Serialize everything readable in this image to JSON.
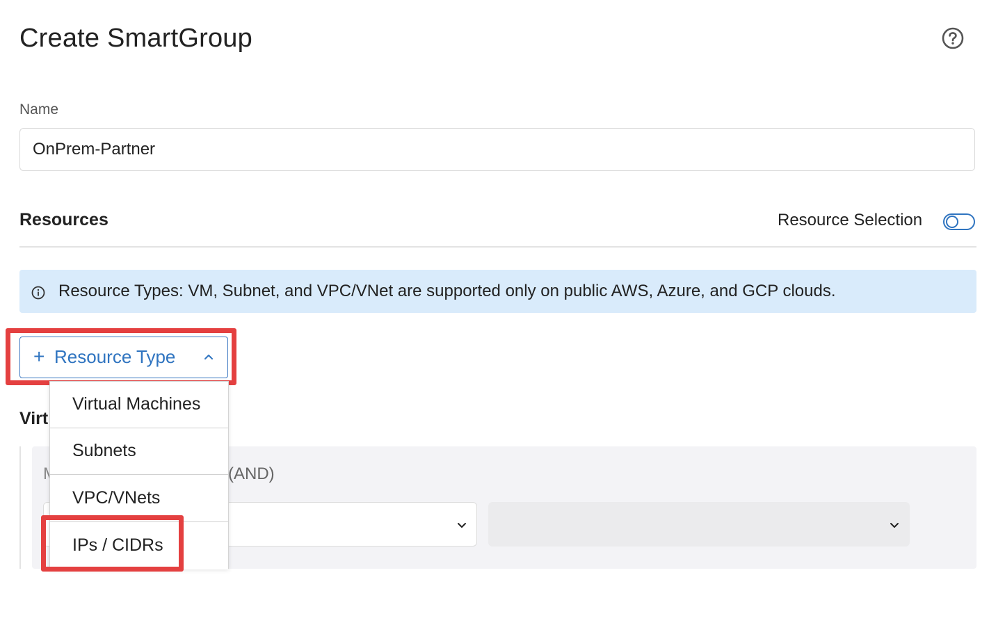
{
  "header": {
    "title": "Create SmartGroup",
    "help_icon": "help-circle-icon"
  },
  "name_field": {
    "label": "Name",
    "value": "OnPrem-Partner"
  },
  "resources": {
    "title": "Resources",
    "selection_label": "Resource Selection",
    "selection_toggle_on": false
  },
  "info_banner": {
    "icon": "info-icon",
    "text": "Resource Types: VM, Subnet, and VPC/VNet are supported only on public AWS, Azure, and GCP clouds."
  },
  "resource_type_button": {
    "plus": "+",
    "label": "Resource Type",
    "chevron_icon": "chevron-up-icon"
  },
  "dropdown": {
    "items": [
      {
        "label": "Virtual Machines"
      },
      {
        "label": "Subnets"
      },
      {
        "label": "VPC/VNets"
      },
      {
        "label": "IPs / CIDRs"
      }
    ]
  },
  "virtual_section": {
    "heading_visible": "Virt",
    "condition_prefix_visible": "M",
    "condition_suffix_visible": "(AND)",
    "select_icon": "chevron-down-icon"
  },
  "colors": {
    "accent": "#2f74c0",
    "highlight": "#e44040",
    "info_bg": "#d9ebfb",
    "panel_bg": "#f3f3f6"
  }
}
